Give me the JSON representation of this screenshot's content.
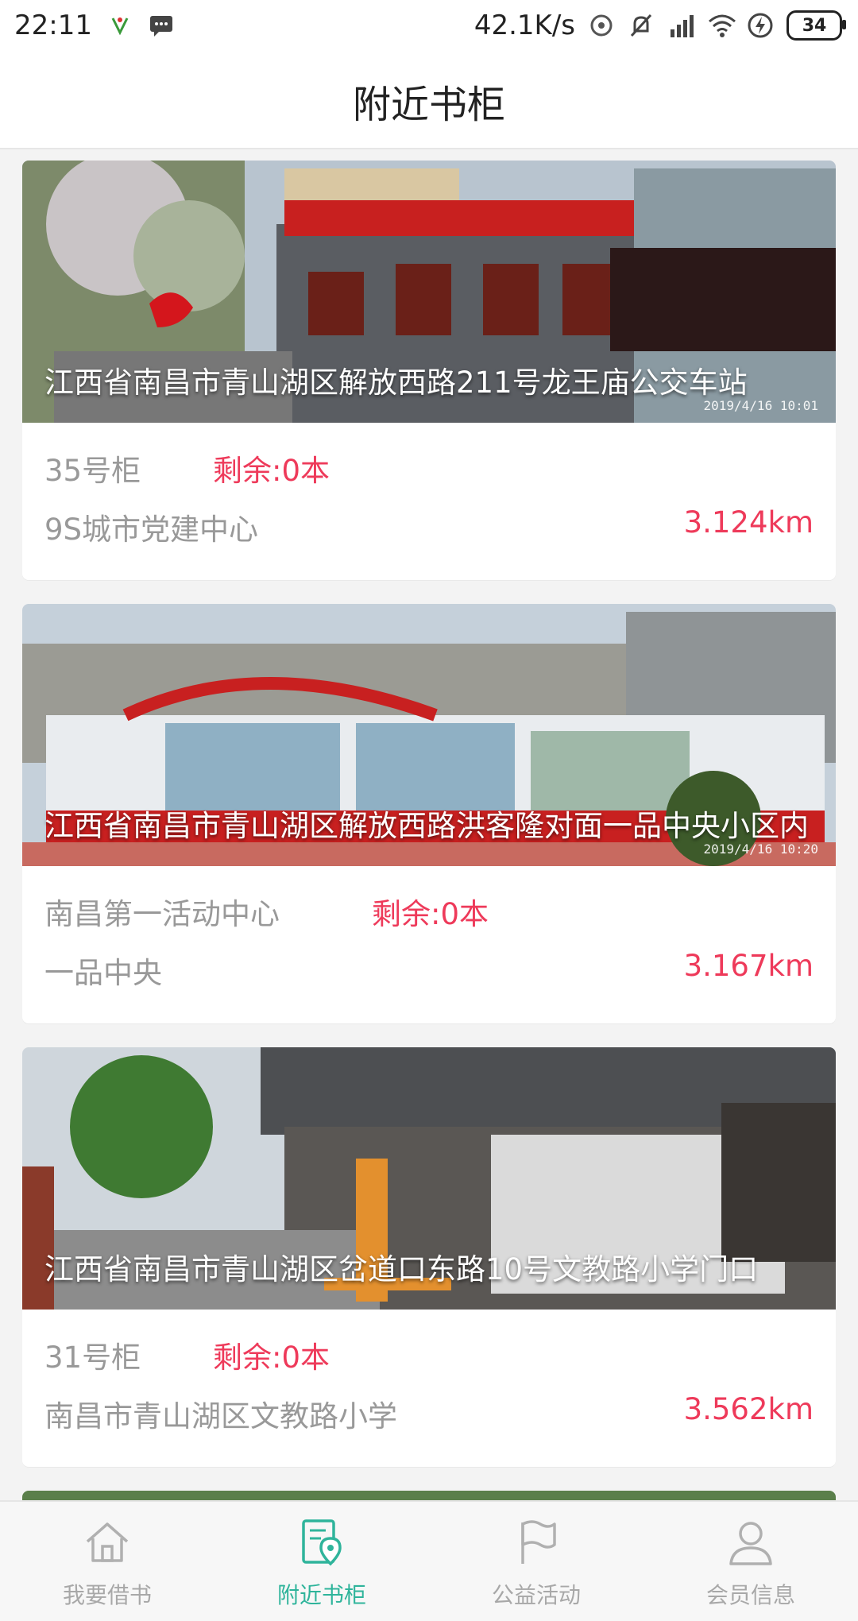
{
  "status_bar": {
    "time": "22:11",
    "speed": "42.1K/s",
    "battery": "34"
  },
  "header": {
    "title": "附近书柜"
  },
  "cards": [
    {
      "address": "江西省南昌市青山湖区解放西路211号龙王庙公交车站",
      "photo_date": "2019/4/16  10:01",
      "cabinet": "35号柜",
      "remaining": "剩余:0本",
      "place": "9S城市党建中心",
      "distance": "3.124km"
    },
    {
      "address": "江西省南昌市青山湖区解放西路洪客隆对面一品中央小区内",
      "photo_date": "2019/4/16  10:20",
      "cabinet": "南昌第一活动中心",
      "remaining": "剩余:0本",
      "place": "一品中央",
      "distance": "3.167km"
    },
    {
      "address": "江西省南昌市青山湖区岔道口东路10号文教路小学门口",
      "cabinet": "31号柜",
      "remaining": "剩余:0本",
      "place": "南昌市青山湖区文教路小学",
      "distance": "3.562km"
    }
  ],
  "bottom_nav": [
    {
      "label": "我要借书",
      "icon": "home-icon",
      "active": false
    },
    {
      "label": "附近书柜",
      "icon": "location-doc-icon",
      "active": true
    },
    {
      "label": "公益活动",
      "icon": "flag-icon",
      "active": false
    },
    {
      "label": "会员信息",
      "icon": "user-icon",
      "active": false
    }
  ],
  "colors": {
    "accent": "#2fb49b",
    "highlight": "#ee3a5a",
    "muted": "#999999"
  }
}
